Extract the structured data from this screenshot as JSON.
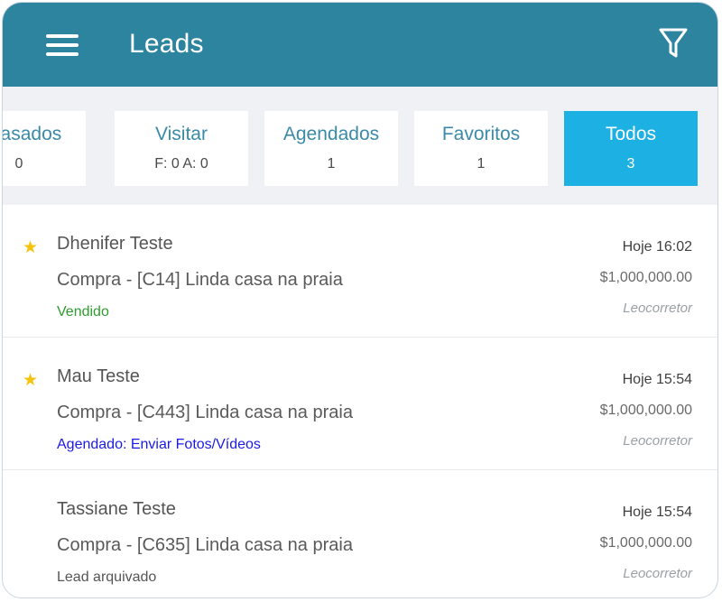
{
  "header": {
    "title": "Leads",
    "menu_icon": "hamburger-menu-icon",
    "filter_icon": "filter-funnel-icon"
  },
  "tabs": [
    {
      "label": "Atrasados",
      "count": "0"
    },
    {
      "label": "Visitar",
      "count": "F: 0 A: 0"
    },
    {
      "label": "Agendados",
      "count": "1"
    },
    {
      "label": "Favoritos",
      "count": "1"
    },
    {
      "label": "Todos",
      "count": "3",
      "active": true
    }
  ],
  "leads": [
    {
      "name": "Dhenifer Teste",
      "favorite": true,
      "property": "Compra - [C14] Linda casa na praia",
      "status": "Vendido",
      "time": "Hoje 16:02",
      "price": "$1,000,000.00",
      "agent": "Leocorretor"
    },
    {
      "name": "Mau Teste",
      "favorite": true,
      "property": "Compra - [C443] Linda casa na praia",
      "status": "Agendado: Enviar Fotos/Vídeos",
      "time": "Hoje 15:54",
      "price": "$1,000,000.00",
      "agent": "Leocorretor"
    },
    {
      "name": "Tassiane Teste",
      "favorite": false,
      "property": "Compra - [C635] Linda casa na praia",
      "status": "Lead arquivado",
      "time": "Hoje 15:54",
      "price": "$1,000,000.00",
      "agent": "Leocorretor"
    }
  ],
  "colors": {
    "appbar": "#2d849f",
    "active_tab": "#1db0e3",
    "status_sold": "#2e9e2e",
    "status_scheduled": "#1a1ae6",
    "status_archived": "#555555",
    "star": "#f5c30c"
  }
}
